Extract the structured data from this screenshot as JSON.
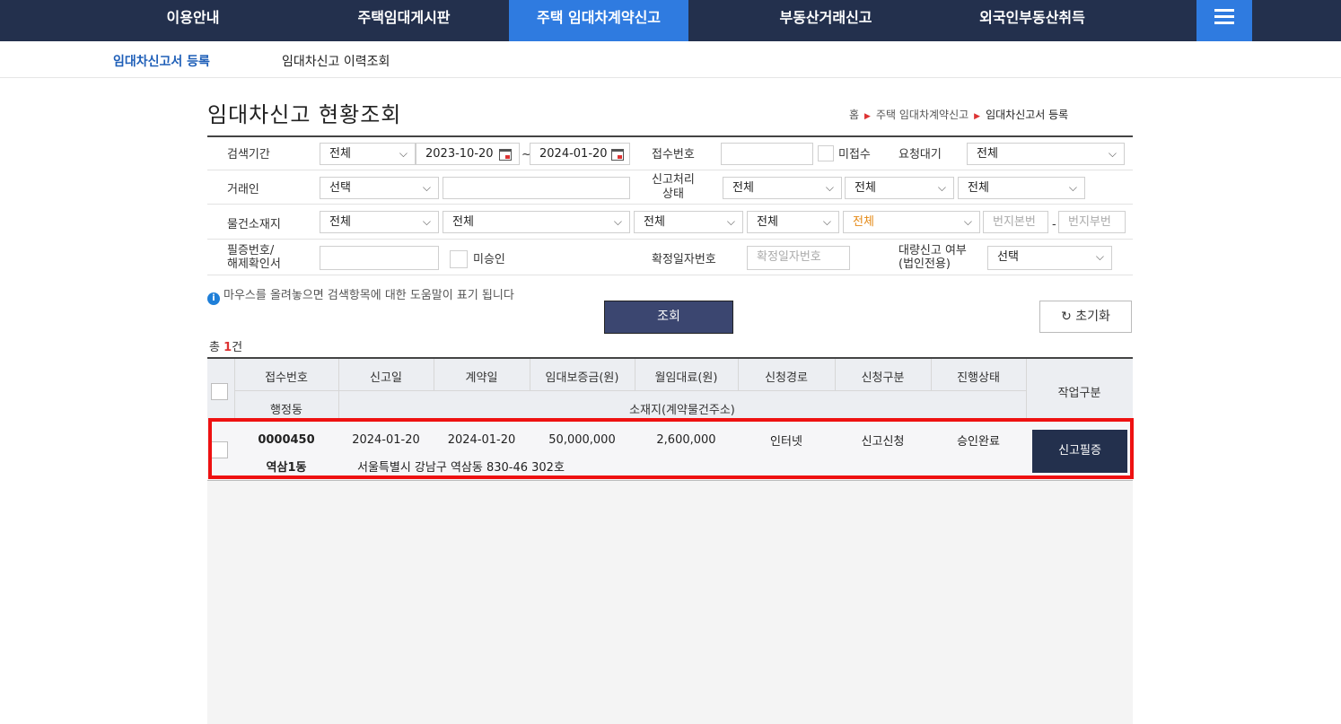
{
  "topnav": {
    "items": [
      "이용안내",
      "주택임대게시판",
      "주택 임대차계약신고",
      "부동산거래신고",
      "외국인부동산취득"
    ],
    "menu_icon": "hamburger-menu-icon",
    "active_color": "#2f7be0",
    "bg_color": "#23304d"
  },
  "subnav": {
    "items": [
      "임대차신고서 등록",
      "임대차신고 이력조회"
    ]
  },
  "page": {
    "title": "임대차신고 현황조회",
    "breadcrumb": [
      "홈",
      "주택 임대차계약신고",
      "임대차신고서 등록"
    ]
  },
  "search": {
    "period_label": "검색기간",
    "period_select": "전체",
    "date_from": "2023-10-20",
    "date_sep": "~",
    "date_to": "2024-01-20",
    "receipt_no_label": "접수번호",
    "receipt_no_value": "",
    "not_received_label": "미접수",
    "pending_label": "요청대기",
    "pending_select": "전체",
    "trader_label": "거래인",
    "trader_select": "선택",
    "trader_value": "",
    "status_label_1": "신고처리",
    "status_label_2": "상태",
    "status_select_1": "전체",
    "status_select_2": "전체",
    "status_select_3": "전체",
    "location_label": "물건소재지",
    "loc_1": "전체",
    "loc_2": "전체",
    "loc_3": "전체",
    "loc_4": "전체",
    "loc_5": "전체",
    "lot_main_placeholder": "번지본번",
    "lot_dash": "-",
    "lot_sub_placeholder": "번지부번",
    "cert_label_1": "필증번호/",
    "cert_label_2": "해제확인서",
    "cert_value": "",
    "unapproved_label": "미승인",
    "fixed_date_label": "확정일자번호",
    "fixed_date_placeholder": "확정일자번호",
    "bulk_label_1": "대량신고 여부",
    "bulk_label_2": "(법인전용)",
    "bulk_select": "선택"
  },
  "info_text": "마우스를 올려놓으면 검색항목에 대한 도움말이 표기 됩니다",
  "buttons": {
    "search": "조회",
    "reset": "초기화",
    "reset_icon": "refresh-icon"
  },
  "total": {
    "prefix": "총 ",
    "count": "1",
    "suffix": "건"
  },
  "grid": {
    "headers_row1": [
      "접수번호",
      "신고일",
      "계약일",
      "임대보증금(원)",
      "월임대료(원)",
      "신청경로",
      "신청구분",
      "진행상태"
    ],
    "header_action": "작업구분",
    "header_dong": "행정동",
    "header_address": "소재지(계약물건주소)",
    "rows": [
      {
        "receipt_no": "0000450",
        "report_date": "2024-01-20",
        "contract_date": "2024-01-20",
        "deposit": "50,000,000",
        "monthly_rent": "2,600,000",
        "channel": "인터넷",
        "type": "신고신청",
        "status": "승인완료",
        "action": "신고필증",
        "dong": "역삼1동",
        "address": "서울특별시 강남구 역삼동 830-46 302호"
      }
    ]
  }
}
